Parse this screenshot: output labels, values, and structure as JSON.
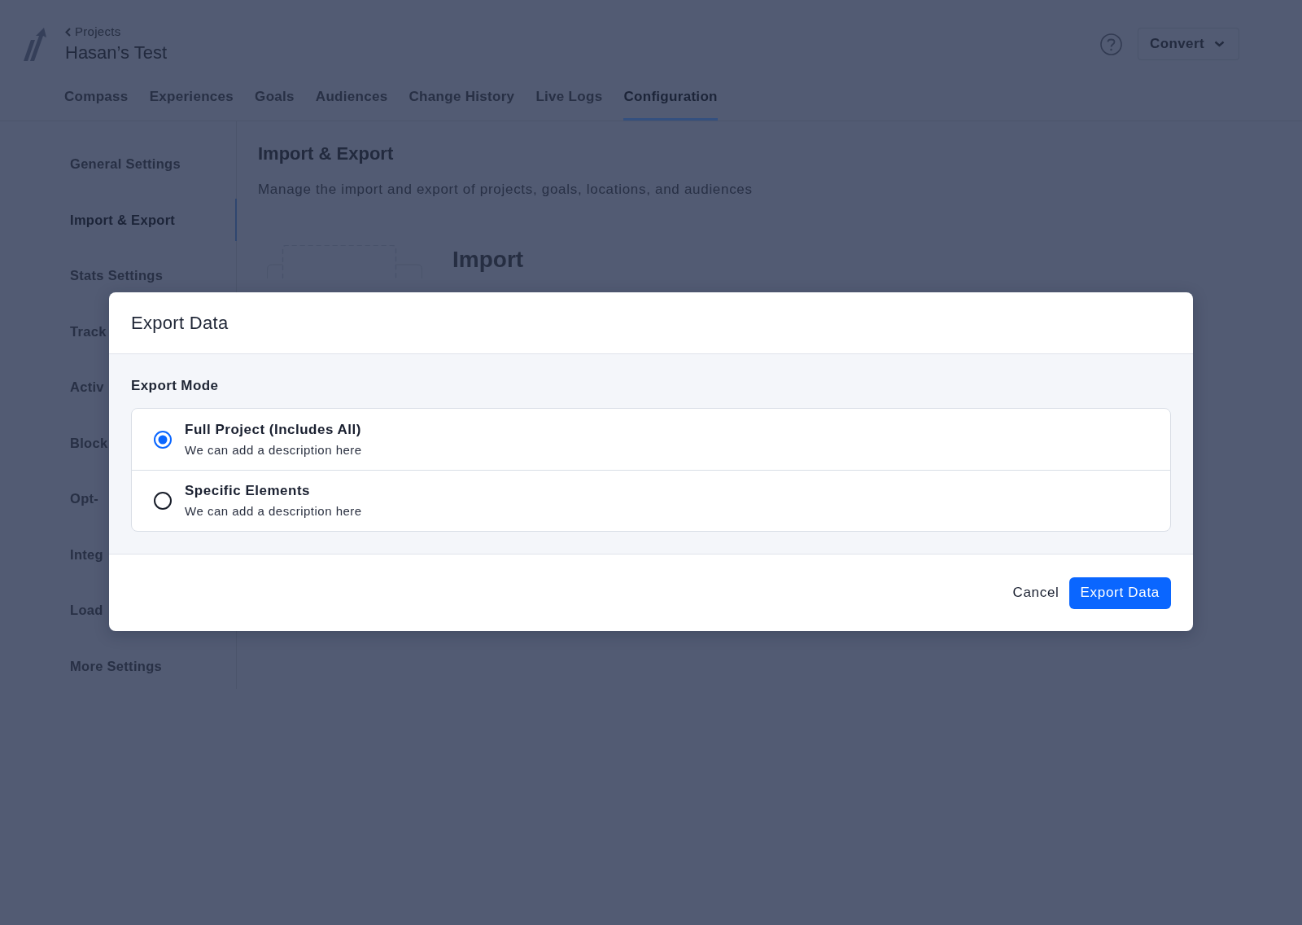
{
  "header": {
    "breadcrumb": "Projects",
    "project_title": "Hasan’s Test",
    "menu_button": "Convert"
  },
  "tabs": [
    {
      "label": "Compass",
      "selected": false
    },
    {
      "label": "Experiences",
      "selected": false
    },
    {
      "label": "Goals",
      "selected": false
    },
    {
      "label": "Audiences",
      "selected": false
    },
    {
      "label": "Change History",
      "selected": false
    },
    {
      "label": "Live Logs",
      "selected": false
    },
    {
      "label": "Configuration",
      "selected": true
    }
  ],
  "sidebar": {
    "items": [
      {
        "label": "General Settings",
        "selected": false
      },
      {
        "label": "Import & Export",
        "selected": true
      },
      {
        "label": "Stats Settings",
        "selected": false
      },
      {
        "label": "Track",
        "selected": false
      },
      {
        "label": "Activ",
        "selected": false
      },
      {
        "label": "Block",
        "selected": false
      },
      {
        "label": "Opt-",
        "selected": false
      },
      {
        "label": "Integ",
        "selected": false
      },
      {
        "label": "Load",
        "selected": false
      },
      {
        "label": "More Settings",
        "selected": false
      }
    ]
  },
  "content": {
    "title": "Import & Export",
    "description": "Manage the import and export of projects, goals, locations, and audiences",
    "section_title": "Import"
  },
  "dialog": {
    "title": "Export Data",
    "field_label": "Export Mode",
    "options": [
      {
        "label": "Full Project (Includes All)",
        "description": "We can add a description here",
        "selected": true
      },
      {
        "label": "Specific Elements",
        "description": "We can add a description here",
        "selected": false
      }
    ],
    "buttons": [
      {
        "label": "Cancel",
        "kind": "secondary"
      },
      {
        "label": "Export Data",
        "kind": "primary"
      }
    ]
  }
}
